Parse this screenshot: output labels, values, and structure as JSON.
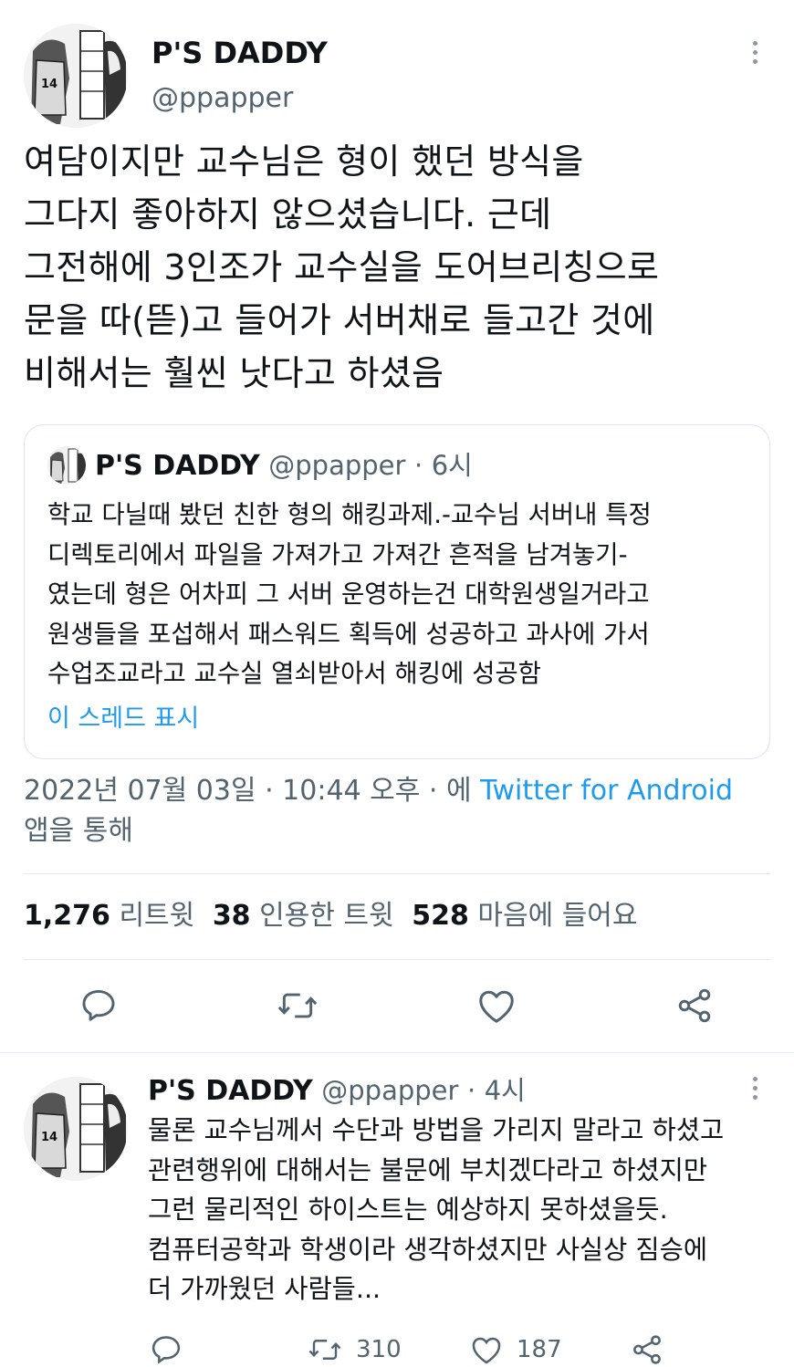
{
  "tweet": {
    "author": {
      "display_name": "P'S DADDY",
      "handle": "@ppapper",
      "avatar_icon": "manga-avatar-icon",
      "jersey_number": "14"
    },
    "more_icon": "more-vertical-icon",
    "text_lines": [
      "여담이지만 교수님은 형이 했던 방식을",
      "그다지 좋아하지 않으셨습니다. 근데",
      "그전해에 3인조가 교수실을 도어브리칭으로",
      "문을 따(뜯)고 들어가 서버채로 들고간 것에",
      "비해서는 훨씬 낫다고 하셨음"
    ],
    "quote": {
      "display_name": "P'S DADDY",
      "handle": "@ppapper",
      "separator": "·",
      "time": "6시",
      "text_lines": [
        "학교 다닐때 봤던 친한 형의 해킹과제.-교수님 서버내 특정",
        "디렉토리에서 파일을 가져가고 가져간 흔적을 남겨놓기-",
        "였는데 형은 어차피 그 서버 운영하는건 대학원생일거라고",
        "원생들을 포섭해서 패스워드 획득에 성공하고 과사에 가서",
        "수업조교라고 교수실 열쇠받아서 해킹에 성공함"
      ],
      "show_thread": "이 스레드 표시"
    },
    "meta": {
      "timestamp": "2022년 07월 03일 · 10:44 오후 · 에",
      "source": "Twitter for Android",
      "suffix": "앱을 통해"
    },
    "stats": {
      "retweets_count": "1,276",
      "retweets_label": "리트윗",
      "quotes_count": "38",
      "quotes_label": "인용한 트윗",
      "likes_count": "528",
      "likes_label": "마음에 들어요"
    },
    "actions": {
      "reply_icon": "reply-icon",
      "retweet_icon": "retweet-icon",
      "like_icon": "heart-icon",
      "share_icon": "share-icon"
    }
  },
  "reply": {
    "author": {
      "display_name": "P'S DADDY",
      "handle": "@ppapper",
      "separator": "·",
      "time": "4시"
    },
    "text_lines": [
      "물론 교수님께서 수단과 방법을 가리지 말라고 하셨고",
      "관련행위에 대해서는 불문에 부치겠다라고 하셨지만",
      "그런 물리적인 하이스트는 예상하지 못하셨을듯.",
      "컴퓨터공학과 학생이라 생각하셨지만 사실상 짐승에",
      "더 가까웠던 사람들..."
    ],
    "actions": {
      "retweet_count": "310",
      "like_count": "187"
    }
  },
  "colors": {
    "text": "#0f1419",
    "muted": "#536471",
    "link": "#1d9bf0",
    "divider": "#e5eaee"
  }
}
